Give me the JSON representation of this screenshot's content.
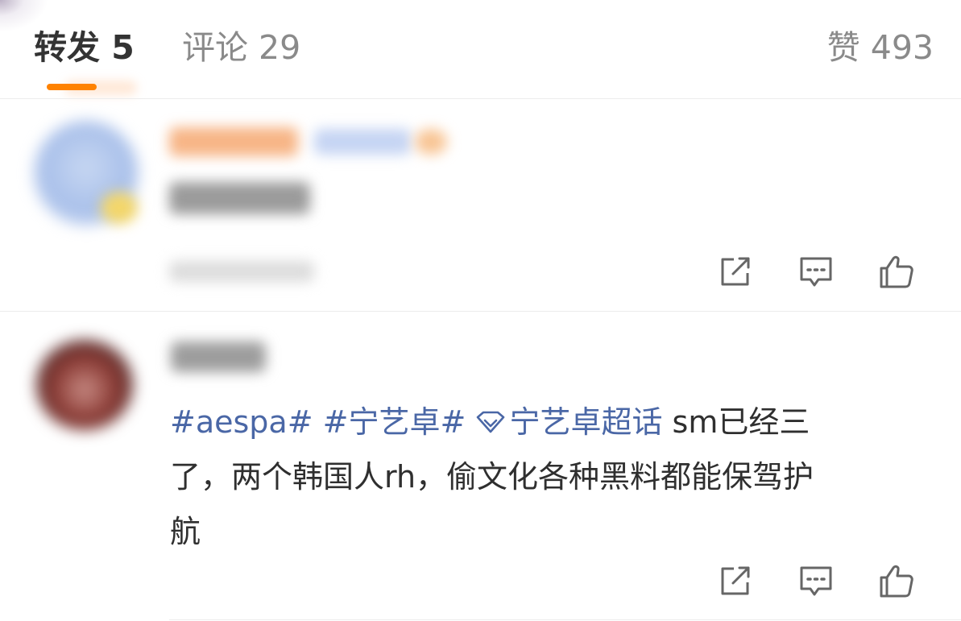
{
  "tabs": {
    "repost_label": "转发",
    "repost_count": "5",
    "comment_label": "评论",
    "comment_count": "29",
    "likes_label": "赞",
    "likes_count": "493"
  },
  "colors": {
    "accent": "#ff8200",
    "hashtag": "#4a67a6",
    "muted": "#8a8a8a"
  },
  "comments": [
    {
      "actions": [
        "share-icon",
        "reply-icon",
        "like-icon"
      ]
    },
    {
      "segments": {
        "tag1": "#aespa#",
        "tag2": "#宁艺卓#",
        "supertopic": "宁艺卓超话",
        "text_a": " sm已经三",
        "text_b": "了，两个韩国人rh，偷文化各种黑料都能保驾护",
        "text_c": "航"
      },
      "actions": [
        "share-icon",
        "reply-icon",
        "like-icon"
      ]
    }
  ]
}
